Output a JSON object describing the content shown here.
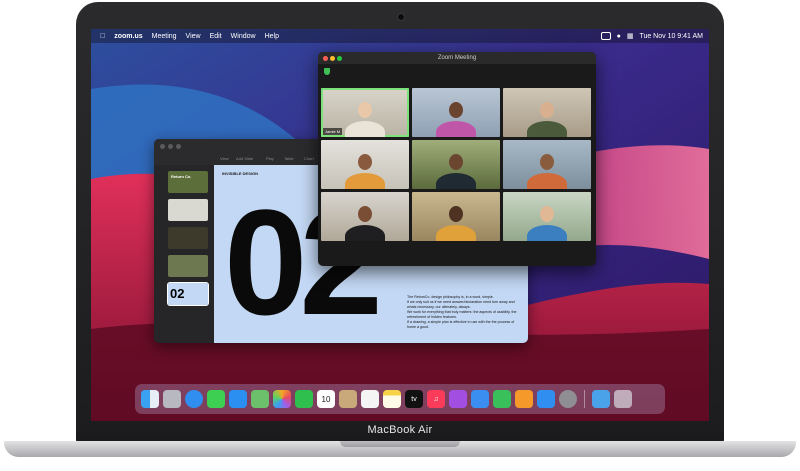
{
  "device": {
    "model": "MacBook Air"
  },
  "menubar": {
    "apple_icon": "apple-icon",
    "app_name": "zoom.us",
    "items": [
      "Meeting",
      "View",
      "Edit",
      "Window",
      "Help"
    ],
    "datetime": "Tue Nov 10  9:41 AM"
  },
  "zoom": {
    "title": "Zoom Meeting",
    "participant_label": "Jamie M",
    "accent": "#7ee27a"
  },
  "keynote": {
    "toolbar_items": [
      "View",
      "Add Slide",
      "Play",
      "Table",
      "Chart"
    ],
    "slide_heading": "INVISIBLE DESIGN",
    "slide_number": "02",
    "slide_body": "The RetomCo. design philosophy is, in a word, simple.\nIf we only suit us if we need answer/declaration need turn away and whats necessary, our ultimately, always.\nWe work for everything that truly matters: the aspects of usability, the refreshment of hidden features.\nIf a drawing, a simple plan is effective in use with the the process of home a good.",
    "thumb_label_1": "Return Co.",
    "thumb_label_5": "02"
  },
  "dock": {
    "icons": [
      "finder-icon",
      "launchpad-icon",
      "safari-icon",
      "messages-icon",
      "mail-icon",
      "maps-icon",
      "photos-icon",
      "facetime-icon",
      "calendar-icon",
      "contacts-icon",
      "reminders-icon",
      "notes-icon",
      "apple-tv-icon",
      "music-icon",
      "podcasts-icon",
      "keynote-icon",
      "numbers-icon",
      "pages-icon",
      "app-store-icon",
      "system-preferences-icon",
      "downloads-folder-icon",
      "trash-icon"
    ],
    "calendar_day": "10",
    "tv_label": "tv"
  }
}
